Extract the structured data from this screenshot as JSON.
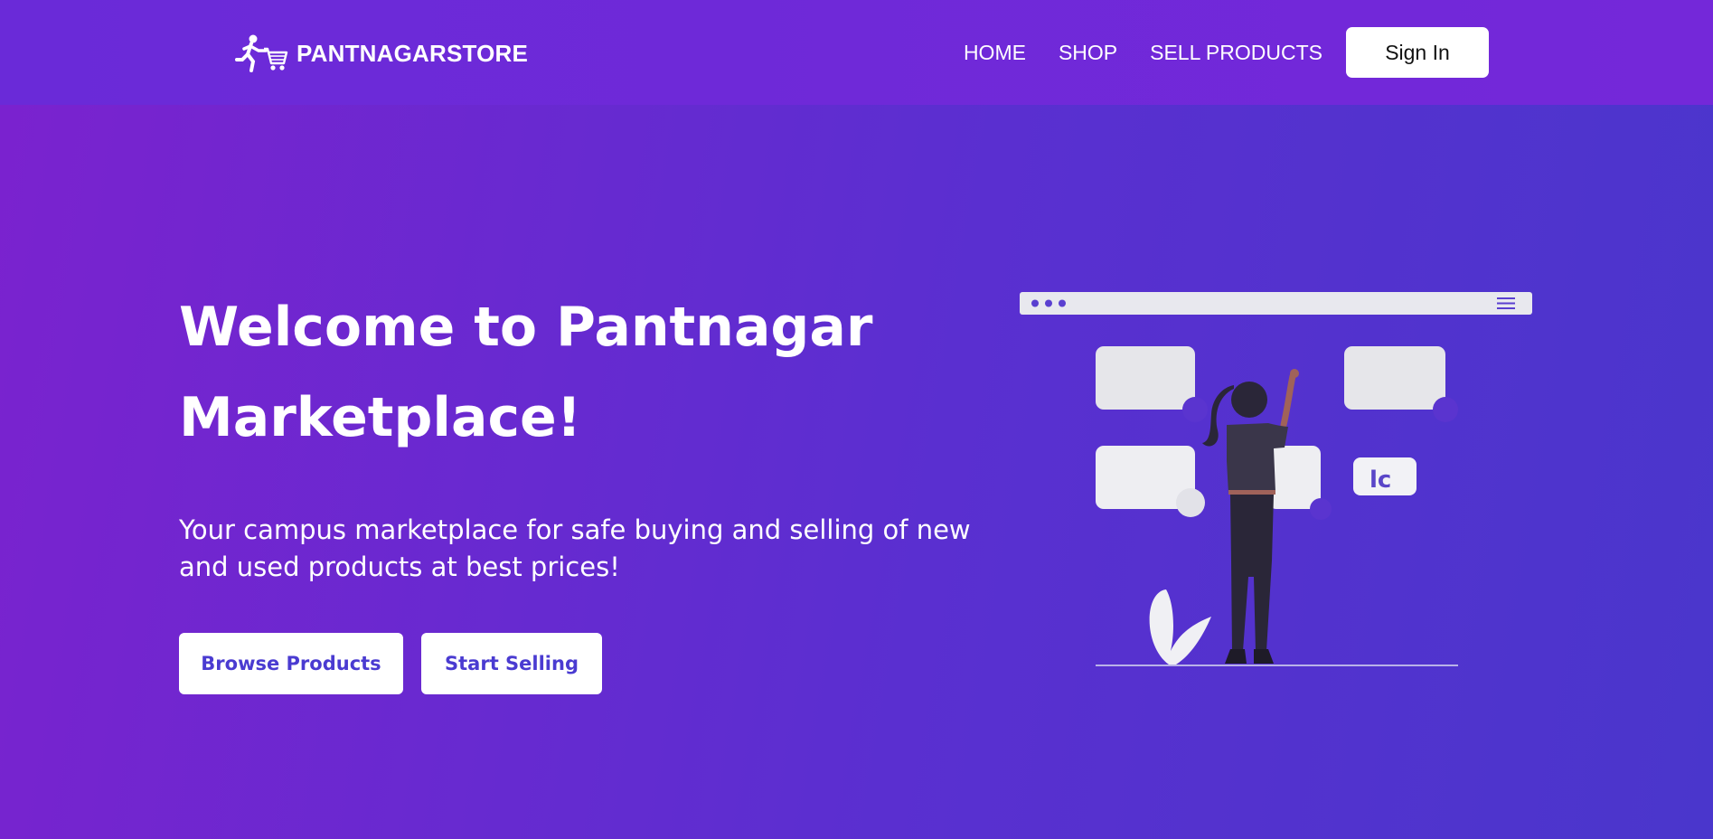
{
  "header": {
    "brand": {
      "logo_icon": "running-shopper-cart-icon",
      "name": "PANTNAGARSTORE"
    },
    "nav": {
      "home": "HOME",
      "shop": "SHOP",
      "sell_products": "SELL PRODUCTS"
    },
    "sign_in": "Sign In"
  },
  "hero": {
    "title": "Welcome to Pantnagar Marketplace!",
    "subtitle": "Your campus marketplace for safe buying and selling of new and used products at best prices!",
    "browse_button": "Browse Products",
    "sell_button": "Start Selling",
    "illustration": "woman-with-content-cards-illustration"
  },
  "colors": {
    "nav_bg": "#6e29d8",
    "hero_gradient_start": "#7b22cf",
    "hero_gradient_end": "#4a36cc",
    "button_text": "#4a3bd1",
    "white": "#ffffff"
  }
}
